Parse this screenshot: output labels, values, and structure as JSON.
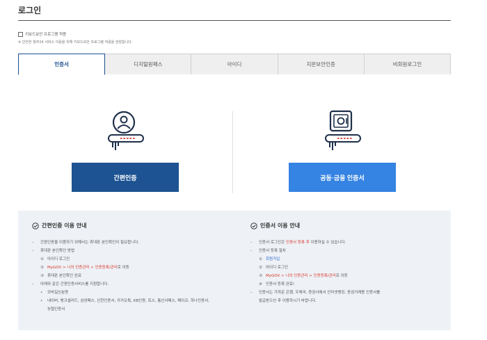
{
  "page": {
    "title": "로그인"
  },
  "keyboard": {
    "checkbox_label": "키보드보안 프로그램 적용",
    "note": "※ 안전한 정부24 서비스 이용을 위해 키보드보안 프로그램 적용을 권장합니다."
  },
  "tabs": [
    {
      "label": "인증서",
      "active": true
    },
    {
      "label": "디지털원패스",
      "active": false
    },
    {
      "label": "아이디",
      "active": false
    },
    {
      "label": "지문보안인증",
      "active": false
    },
    {
      "label": "비회원로그인",
      "active": false
    }
  ],
  "auth": {
    "simple_button": "간편인증",
    "cert_button": "공동·금융 인증서",
    "simple_icon": "person-key-icon",
    "cert_icon": "safe-key-icon",
    "colors": {
      "dark": "#1d5392",
      "light": "#3583e2",
      "accent": "#d9342b"
    }
  },
  "info": {
    "simple": {
      "title": "간편인증 이용 안내",
      "l1": "간편인증을 이용하기 위해서는 휴대폰 본인확인이 필요합니다.",
      "l2": "휴대폰 본인확인 방법",
      "s1_num": "①",
      "s1": "아이디 로그인",
      "s2_num": "②",
      "s2_path": "MyGOV > 나의 인증관리 > 인증등록/관리",
      "s2_tail": "로 이동",
      "s3_num": "③",
      "s3": "휴대폰 본인확인 완료",
      "l3": "아래와 같은 간편인증서비스를 지원합니다.",
      "b1": "모바일신분증",
      "b2": "네이버, 뱅크샐러드, 삼성패스, 신한인증서, 카카오톡, KB인증, 토스, 통신사패스, 페이코, 하나인증서,",
      "b2_cont": "농협인증서"
    },
    "cert": {
      "title": "인증서 이용 안내",
      "l1_pre": "인증서 로그인은 ",
      "l1_red": "인증서 등록 후",
      "l1_post": " 이용하실 수 있습니다.",
      "l2": "인증서 등록 절차",
      "s1_num": "①",
      "s1": "회원가입",
      "s2_num": "②",
      "s2": "아이디 로그인",
      "s3_num": "③",
      "s3_path": "MyGOV > 나의 인증관리 > 인증등록/관리",
      "s3_tail": "로 이동",
      "s4_num": "④",
      "s4": "인증서 등록 완료!",
      "l3": "인증서는 가까운 은행, 우체국, 증권사에서 인터넷뱅킹, 증권거래용 인증서를",
      "l3_cont": "발급받으신 후 이용하시기 바랍니다."
    }
  }
}
